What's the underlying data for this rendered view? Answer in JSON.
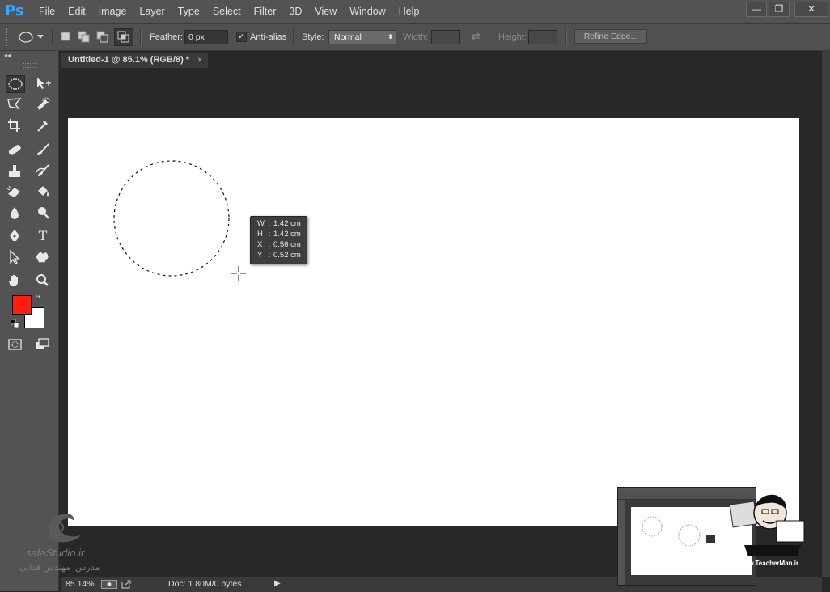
{
  "app": {
    "logo": "Ps"
  },
  "menu": [
    "File",
    "Edit",
    "Image",
    "Layer",
    "Type",
    "Select",
    "Filter",
    "3D",
    "View",
    "Window",
    "Help"
  ],
  "window_controls": {
    "minimize": "—",
    "restore": "❐",
    "close": "✕"
  },
  "options": {
    "feather_label": "Feather:",
    "feather_value": "0 px",
    "antialias_label": "Anti-alias",
    "antialias_checked": true,
    "style_label": "Style:",
    "style_value": "Normal",
    "width_label": "Width:",
    "height_label": "Height:",
    "refine_edge_label": "Refine Edge...",
    "swap_icon": "swap-icon"
  },
  "document": {
    "tab_title": "Untitled-1 @ 85.1% (RGB/8) *",
    "tab_close": "×"
  },
  "tooltip": {
    "rows": [
      {
        "key": "W",
        "value": "1.42 cm"
      },
      {
        "key": "H",
        "value": "1.42 cm"
      },
      {
        "key": "X",
        "value": "0.56 cm"
      },
      {
        "key": "Y",
        "value": "0.52 cm"
      }
    ]
  },
  "status": {
    "zoom": "85.14%",
    "doc_info": "Doc: 1.80M/0 bytes"
  },
  "colors": {
    "foreground": "#ff1e0a",
    "background": "#ffffff",
    "ps_blue": "#31a8ff"
  },
  "watermarks": {
    "left_site": "safaStudio.ir",
    "left_caption": "مدرس: مهندس فدائی",
    "right_site": "www.TeacherMan.ir"
  }
}
